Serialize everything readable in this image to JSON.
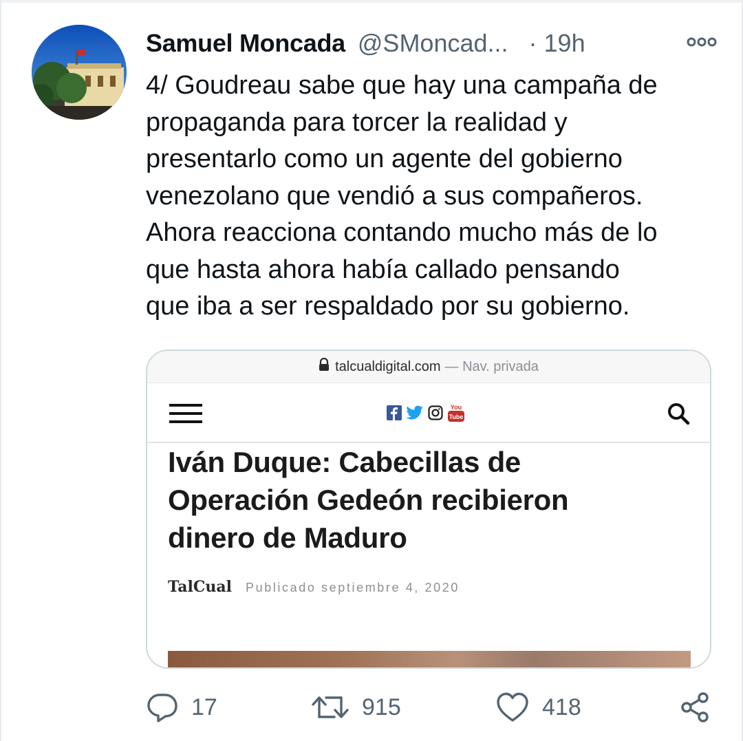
{
  "tweet": {
    "author_name": "Samuel Moncada",
    "handle": "@SMoncad...",
    "separator": "·",
    "time": "19h",
    "text": "4/ Goudreau sabe que hay una campaña de\npropaganda para torcer la realidad y\npresentarlo como un agente del gobierno\nvenezolano que vendió a sus compañeros.\nAhora reacciona contando mucho más de lo\nque hasta ahora había callado pensando\nque iba a ser respaldado por su gobierno."
  },
  "card": {
    "url": "talcualdigital.com",
    "url_suffix": "— Nav. privada",
    "article_title": "Iván Duque: Cabecillas de Operación Gedeón recibieron dinero de Maduro",
    "brand": "TalCual",
    "published": "Publicado septiembre 4, 2020",
    "social_icons": [
      "facebook-icon",
      "twitter-icon",
      "instagram-icon",
      "youtube-icon"
    ]
  },
  "actions": {
    "reply_count": "17",
    "retweet_count": "915",
    "like_count": "418"
  },
  "colors": {
    "text": "#0f1419",
    "secondary": "#536471",
    "border": "#cfd9de"
  }
}
